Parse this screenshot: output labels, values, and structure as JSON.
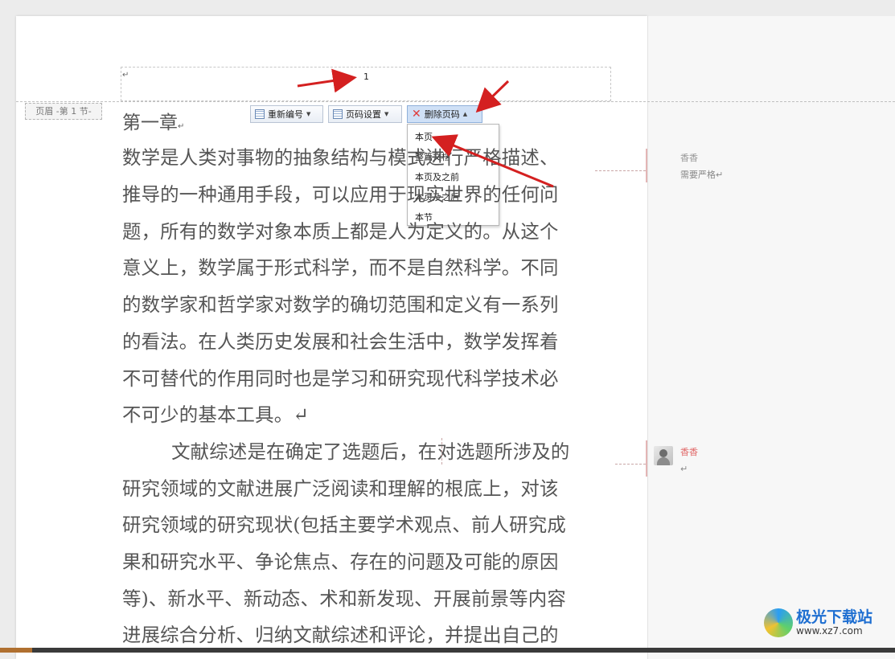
{
  "header": {
    "page_number": "1",
    "section_label": "页眉 -第 1 节-",
    "para_mark": "↵"
  },
  "toolbar": {
    "renumber_label": "重新编号",
    "page_number_settings_label": "页码设置",
    "delete_page_number_label": "删除页码"
  },
  "dropdown": {
    "items": [
      "本页",
      "整篇文档",
      "本页及之前",
      "本页及之后",
      "本节"
    ]
  },
  "document": {
    "chapter_title": "第一章",
    "lines": [
      "数学是人类对事物的抽象结构与模式进行严格描述、",
      "推导的一种通用手段，可以应用于现实世界的任何问",
      "题，所有的数学对象本质上都是人为定义的。从这个",
      "意义上，数学属于形式科学，而不是自然科学。不同",
      "的数学家和哲学家对数学的确切范围和定义有一系列",
      "的看法。在人类历史发展和社会生活中，数学发挥着",
      "不可替代的作用同时也是学习和研究现代科学技术必",
      "不可少的基本工具。↵",
      "        文献综述是在确定了选题后，在对选题所涉及的",
      "研究领域的文献进展广泛阅读和理解的根底上，对该",
      "研究领域的研究现状(包括主要学术观点、前人研究成",
      "果和研究水平、争论焦点、存在的问题及可能的原因",
      "等)、新水平、新动态、术和新发现、开展前景等内容",
      "进展综合分析、归纳文献综述和评论，并提出自己的"
    ]
  },
  "comments": [
    {
      "author": "香香",
      "text": "需要严格↵"
    },
    {
      "author": "香香",
      "text": "↵"
    }
  ],
  "watermark": {
    "title": "极光下载站",
    "url": "www.xz7.com"
  },
  "colors": {
    "annotation_arrow": "#d42020",
    "comment_author_active": "#e06a6a",
    "comment_author": "#999999"
  }
}
